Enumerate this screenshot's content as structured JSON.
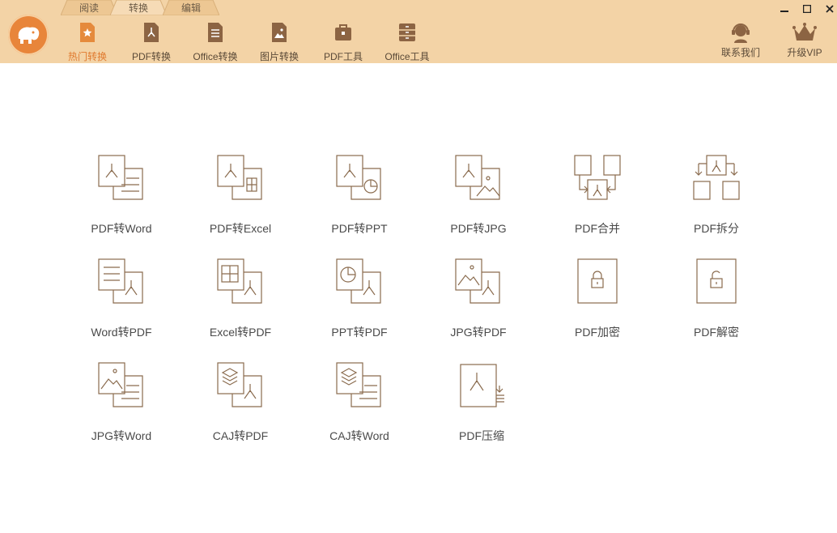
{
  "tabs": [
    {
      "label": "阅读"
    },
    {
      "label": "转换"
    },
    {
      "label": "编辑"
    }
  ],
  "toolbar": [
    {
      "label": "热门转换",
      "icon": "star-doc-icon"
    },
    {
      "label": "PDF转换",
      "icon": "pdf-doc-icon"
    },
    {
      "label": "Office转换",
      "icon": "office-doc-icon"
    },
    {
      "label": "图片转换",
      "icon": "image-doc-icon"
    },
    {
      "label": "PDF工具",
      "icon": "toolbox-icon"
    },
    {
      "label": "Office工具",
      "icon": "cabinet-icon"
    }
  ],
  "right_tools": [
    {
      "label": "联系我们",
      "icon": "headset-icon"
    },
    {
      "label": "升级VIP",
      "icon": "crown-icon"
    }
  ],
  "window_controls": {
    "minimize": "▬",
    "maximize": "□",
    "close": "✕"
  },
  "features": [
    {
      "label": "PDF转Word"
    },
    {
      "label": "PDF转Excel"
    },
    {
      "label": "PDF转PPT"
    },
    {
      "label": "PDF转JPG"
    },
    {
      "label": "PDF合并"
    },
    {
      "label": "PDF拆分"
    },
    {
      "label": "Word转PDF"
    },
    {
      "label": "Excel转PDF"
    },
    {
      "label": "PPT转PDF"
    },
    {
      "label": "JPG转PDF"
    },
    {
      "label": "PDF加密"
    },
    {
      "label": "PDF解密"
    },
    {
      "label": "JPG转Word"
    },
    {
      "label": "CAJ转PDF"
    },
    {
      "label": "CAJ转Word"
    },
    {
      "label": "PDF压缩"
    }
  ],
  "colors": {
    "header": "#f3d3a6",
    "accent": "#e07a2e",
    "icon_stroke": "#8a6b4e"
  }
}
